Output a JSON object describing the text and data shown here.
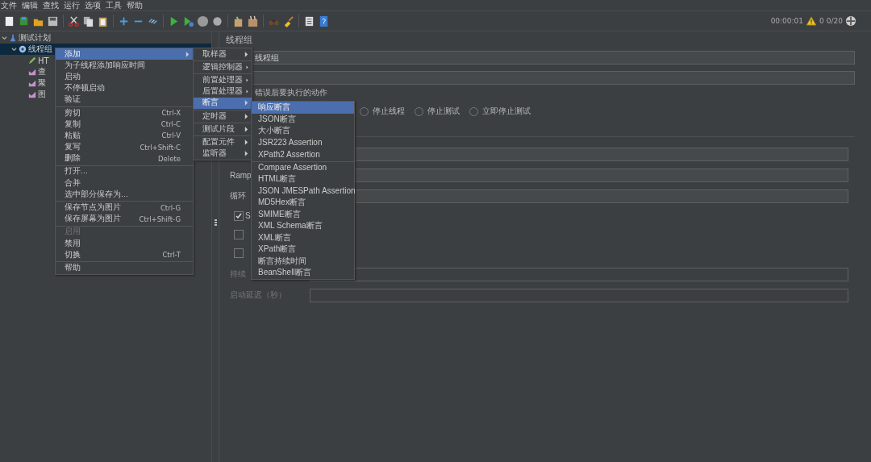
{
  "menubar": [
    "文件",
    "编辑",
    "查找",
    "运行",
    "选项",
    "工具",
    "帮助"
  ],
  "status": {
    "timer": "00:00:01",
    "warnings": "0",
    "threads": "0/20"
  },
  "tree": [
    {
      "label": "测试计划",
      "kind": "plan",
      "selected": false,
      "expanded": true,
      "children": [
        {
          "label": "线程组",
          "kind": "thread-group",
          "selected": true,
          "expanded": true,
          "children": [
            {
              "label": "HT",
              "kind": "sampler",
              "selected": false
            },
            {
              "label": "查",
              "kind": "listener",
              "selected": false
            },
            {
              "label": "聚",
              "kind": "listener",
              "selected": false
            },
            {
              "label": "图",
              "kind": "listener",
              "selected": false
            }
          ]
        }
      ]
    }
  ],
  "panel": {
    "title": "线程组",
    "name_value": "线程组",
    "action_label": "错误后要执行的动作",
    "radios": [
      {
        "label": "停止线程",
        "selected": false
      },
      {
        "label": "停止测试",
        "selected": false
      },
      {
        "label": "立即停止测试",
        "selected": false
      }
    ],
    "rows": [
      {
        "kind": "field",
        "label": ""
      },
      {
        "kind": "field",
        "label": "Ramp"
      },
      {
        "kind": "field",
        "label": "循环"
      },
      {
        "kind": "check",
        "label": "S",
        "checked": true
      },
      {
        "kind": "check",
        "label": "",
        "checked": false
      },
      {
        "kind": "check",
        "label": "",
        "checked": false
      },
      {
        "kind": "field",
        "label": "持续",
        "disabled": true
      },
      {
        "kind": "field",
        "label": "启动延迟（秒）",
        "disabled": true
      }
    ]
  },
  "menus": [
    {
      "groups": [
        {
          "items": [
            {
              "label": "添加",
              "submenu": true,
              "selected": true,
              "disabled": false
            },
            {
              "label": "为子线程添加响应时间",
              "submenu": false,
              "selected": false,
              "disabled": false
            },
            {
              "label": "启动",
              "submenu": false,
              "selected": false,
              "disabled": false
            },
            {
              "label": "不停顿启动",
              "submenu": false,
              "selected": false,
              "disabled": false
            },
            {
              "label": "验证",
              "submenu": false,
              "selected": false,
              "disabled": false
            }
          ]
        },
        {
          "items": [
            {
              "label": "剪切",
              "shortcut": "Ctrl-X",
              "submenu": false,
              "selected": false,
              "disabled": false
            },
            {
              "label": "复制",
              "shortcut": "Ctrl-C",
              "submenu": false,
              "selected": false,
              "disabled": false
            },
            {
              "label": "粘贴",
              "shortcut": "Ctrl-V",
              "submenu": false,
              "selected": false,
              "disabled": false
            },
            {
              "label": "复写",
              "shortcut": "Ctrl+Shift-C",
              "submenu": false,
              "selected": false,
              "disabled": false
            },
            {
              "label": "删除",
              "shortcut": "Delete",
              "submenu": false,
              "selected": false,
              "disabled": false
            }
          ]
        },
        {
          "items": [
            {
              "label": "打开...",
              "submenu": false,
              "selected": false,
              "disabled": false
            },
            {
              "label": "合并",
              "submenu": false,
              "selected": false,
              "disabled": false
            },
            {
              "label": "选中部分保存为...",
              "submenu": false,
              "selected": false,
              "disabled": false
            }
          ]
        },
        {
          "items": [
            {
              "label": "保存节点为图片",
              "shortcut": "Ctrl-G",
              "submenu": false,
              "selected": false,
              "disabled": false
            },
            {
              "label": "保存屏幕为图片",
              "shortcut": "Ctrl+Shift-G",
              "submenu": false,
              "selected": false,
              "disabled": false
            }
          ]
        },
        {
          "items": [
            {
              "label": "启用",
              "submenu": false,
              "selected": false,
              "disabled": true
            },
            {
              "label": "禁用",
              "submenu": false,
              "selected": false,
              "disabled": false
            },
            {
              "label": "切换",
              "shortcut": "Ctrl-T",
              "submenu": false,
              "selected": false,
              "disabled": false
            }
          ]
        },
        {
          "items": [
            {
              "label": "帮助",
              "submenu": false,
              "selected": false,
              "disabled": false
            }
          ]
        }
      ]
    },
    {
      "groups": [
        {
          "items": [
            {
              "label": "取样器",
              "submenu": true,
              "selected": false
            }
          ]
        },
        {
          "items": [
            {
              "label": "逻辑控制器",
              "submenu": true,
              "selected": false
            }
          ]
        },
        {
          "items": [
            {
              "label": "前置处理器",
              "submenu": true,
              "selected": false
            },
            {
              "label": "后置处理器",
              "submenu": true,
              "selected": false
            },
            {
              "label": "断言",
              "submenu": true,
              "selected": true
            }
          ]
        },
        {
          "items": [
            {
              "label": "定时器",
              "submenu": true,
              "selected": false
            }
          ]
        },
        {
          "items": [
            {
              "label": "测试片段",
              "submenu": true,
              "selected": false
            }
          ]
        },
        {
          "items": [
            {
              "label": "配置元件",
              "submenu": true,
              "selected": false
            },
            {
              "label": "监听器",
              "submenu": true,
              "selected": false
            }
          ]
        }
      ]
    },
    {
      "groups": [
        {
          "items": [
            {
              "label": "响应断言",
              "selected": true
            },
            {
              "label": "JSON断言",
              "selected": false
            },
            {
              "label": "大小断言",
              "selected": false
            },
            {
              "label": "JSR223 Assertion",
              "selected": false
            },
            {
              "label": "XPath2 Assertion",
              "selected": false
            }
          ]
        },
        {
          "items": [
            {
              "label": "Compare Assertion",
              "selected": false
            },
            {
              "label": "HTML断言",
              "selected": false
            },
            {
              "label": "JSON JMESPath Assertion",
              "selected": false
            },
            {
              "label": "MD5Hex断言",
              "selected": false
            },
            {
              "label": "SMIME断言",
              "selected": false
            },
            {
              "label": "XML Schema断言",
              "selected": false
            },
            {
              "label": "XML断言",
              "selected": false
            },
            {
              "label": "XPath断言",
              "selected": false
            },
            {
              "label": "断言持续时间",
              "selected": false
            },
            {
              "label": "BeanShell断言",
              "selected": false
            }
          ]
        }
      ]
    }
  ]
}
